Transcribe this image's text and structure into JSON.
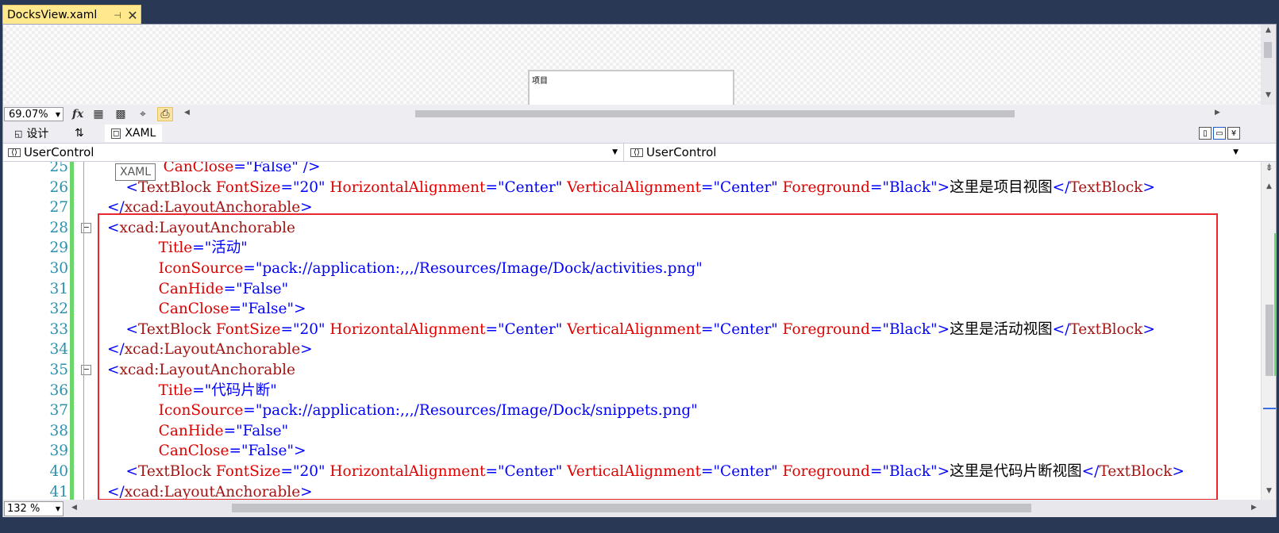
{
  "tab": {
    "title": "DocksView.xaml",
    "pin_icon": "pin-icon",
    "close_glyph": "✕"
  },
  "designer": {
    "box_label": "项目",
    "zoom": "69.07%",
    "toolbar_icons": [
      "fx-icon",
      "grid-icon",
      "snap-grid-icon",
      "snap-lines-icon",
      "device-icon"
    ],
    "fx_label": "fx"
  },
  "split_tabs": {
    "design": "设计",
    "swap": "⇅",
    "xaml": "XAML"
  },
  "navbar": {
    "left": "UserControl",
    "right": "UserControl"
  },
  "tooltip": "XAML",
  "code_lines": [
    {
      "no": "25",
      "parts": [
        [
          "k",
          "            CanClose"
        ],
        [
          "p",
          "="
        ],
        [
          "v",
          "\"False\""
        ],
        [
          "p",
          " />"
        ]
      ]
    },
    {
      "no": "26",
      "parts": [
        [
          "p",
          "    <"
        ],
        [
          "b",
          "TextBlock"
        ],
        [
          "k",
          " FontSize"
        ],
        [
          "p",
          "="
        ],
        [
          "v",
          "\"20\""
        ],
        [
          "k",
          " HorizontalAlignment"
        ],
        [
          "p",
          "="
        ],
        [
          "v",
          "\"Center\""
        ],
        [
          "k",
          " VerticalAlignment"
        ],
        [
          "p",
          "="
        ],
        [
          "v",
          "\"Center\""
        ],
        [
          "k",
          " Foreground"
        ],
        [
          "p",
          "="
        ],
        [
          "v",
          "\"Black\""
        ],
        [
          "p",
          ">"
        ],
        [
          "tx",
          "这里是项目视图"
        ],
        [
          "p",
          "</"
        ],
        [
          "b",
          "TextBlock"
        ],
        [
          "p",
          ">"
        ]
      ]
    },
    {
      "no": "27",
      "parts": [
        [
          "p",
          "</"
        ],
        [
          "b",
          "xcad:LayoutAnchorable"
        ],
        [
          "p",
          ">"
        ]
      ]
    },
    {
      "no": "28",
      "fold": "−",
      "parts": [
        [
          "p",
          "<"
        ],
        [
          "b",
          "xcad:LayoutAnchorable"
        ]
      ]
    },
    {
      "no": "29",
      "parts": [
        [
          "k",
          "           Title"
        ],
        [
          "p",
          "="
        ],
        [
          "v",
          "\"活动\""
        ]
      ]
    },
    {
      "no": "30",
      "parts": [
        [
          "k",
          "           IconSource"
        ],
        [
          "p",
          "="
        ],
        [
          "v",
          "\"pack://application:,,,/Resources/Image/Dock/activities.png\""
        ]
      ]
    },
    {
      "no": "31",
      "parts": [
        [
          "k",
          "           CanHide"
        ],
        [
          "p",
          "="
        ],
        [
          "v",
          "\"False\""
        ]
      ]
    },
    {
      "no": "32",
      "parts": [
        [
          "k",
          "           CanClose"
        ],
        [
          "p",
          "="
        ],
        [
          "v",
          "\"False\""
        ],
        [
          "p",
          ">"
        ]
      ]
    },
    {
      "no": "33",
      "parts": [
        [
          "p",
          "    <"
        ],
        [
          "b",
          "TextBlock"
        ],
        [
          "k",
          " FontSize"
        ],
        [
          "p",
          "="
        ],
        [
          "v",
          "\"20\""
        ],
        [
          "k",
          " HorizontalAlignment"
        ],
        [
          "p",
          "="
        ],
        [
          "v",
          "\"Center\""
        ],
        [
          "k",
          " VerticalAlignment"
        ],
        [
          "p",
          "="
        ],
        [
          "v",
          "\"Center\""
        ],
        [
          "k",
          " Foreground"
        ],
        [
          "p",
          "="
        ],
        [
          "v",
          "\"Black\""
        ],
        [
          "p",
          ">"
        ],
        [
          "tx",
          "这里是活动视图"
        ],
        [
          "p",
          "</"
        ],
        [
          "b",
          "TextBlock"
        ],
        [
          "p",
          ">"
        ]
      ]
    },
    {
      "no": "34",
      "parts": [
        [
          "p",
          "</"
        ],
        [
          "b",
          "xcad:LayoutAnchorable"
        ],
        [
          "p",
          ">"
        ]
      ]
    },
    {
      "no": "35",
      "fold": "−",
      "parts": [
        [
          "p",
          "<"
        ],
        [
          "b",
          "xcad:LayoutAnchorable"
        ]
      ]
    },
    {
      "no": "36",
      "parts": [
        [
          "k",
          "           Title"
        ],
        [
          "p",
          "="
        ],
        [
          "v",
          "\"代码片断\""
        ]
      ]
    },
    {
      "no": "37",
      "parts": [
        [
          "k",
          "           IconSource"
        ],
        [
          "p",
          "="
        ],
        [
          "v",
          "\"pack://application:,,,/Resources/Image/Dock/snippets.png\""
        ]
      ]
    },
    {
      "no": "38",
      "parts": [
        [
          "k",
          "           CanHide"
        ],
        [
          "p",
          "="
        ],
        [
          "v",
          "\"False\""
        ]
      ]
    },
    {
      "no": "39",
      "parts": [
        [
          "k",
          "           CanClose"
        ],
        [
          "p",
          "="
        ],
        [
          "v",
          "\"False\""
        ],
        [
          "p",
          ">"
        ]
      ]
    },
    {
      "no": "40",
      "parts": [
        [
          "p",
          "    <"
        ],
        [
          "b",
          "TextBlock"
        ],
        [
          "k",
          " FontSize"
        ],
        [
          "p",
          "="
        ],
        [
          "v",
          "\"20\""
        ],
        [
          "k",
          " HorizontalAlignment"
        ],
        [
          "p",
          "="
        ],
        [
          "v",
          "\"Center\""
        ],
        [
          "k",
          " VerticalAlignment"
        ],
        [
          "p",
          "="
        ],
        [
          "v",
          "\"Center\""
        ],
        [
          "k",
          " Foreground"
        ],
        [
          "p",
          "="
        ],
        [
          "v",
          "\"Black\""
        ],
        [
          "p",
          ">"
        ],
        [
          "tx",
          "这里是代码片断视图"
        ],
        [
          "p",
          "</"
        ],
        [
          "b",
          "TextBlock"
        ],
        [
          "p",
          ">"
        ]
      ]
    },
    {
      "no": "41",
      "parts": [
        [
          "p",
          "</"
        ],
        [
          "b",
          "xcad:LayoutAnchorable"
        ],
        [
          "p",
          ">"
        ]
      ]
    }
  ],
  "editor_zoom": "132 %",
  "colors": {
    "chrome": "#293955",
    "tab_active": "#ffe98c",
    "line_number": "#2b91af",
    "element": "#a31515",
    "attribute": "#e00000",
    "value": "#0000ff",
    "highlight_border": "#e8272f",
    "change_bar": "#6cd66c"
  }
}
